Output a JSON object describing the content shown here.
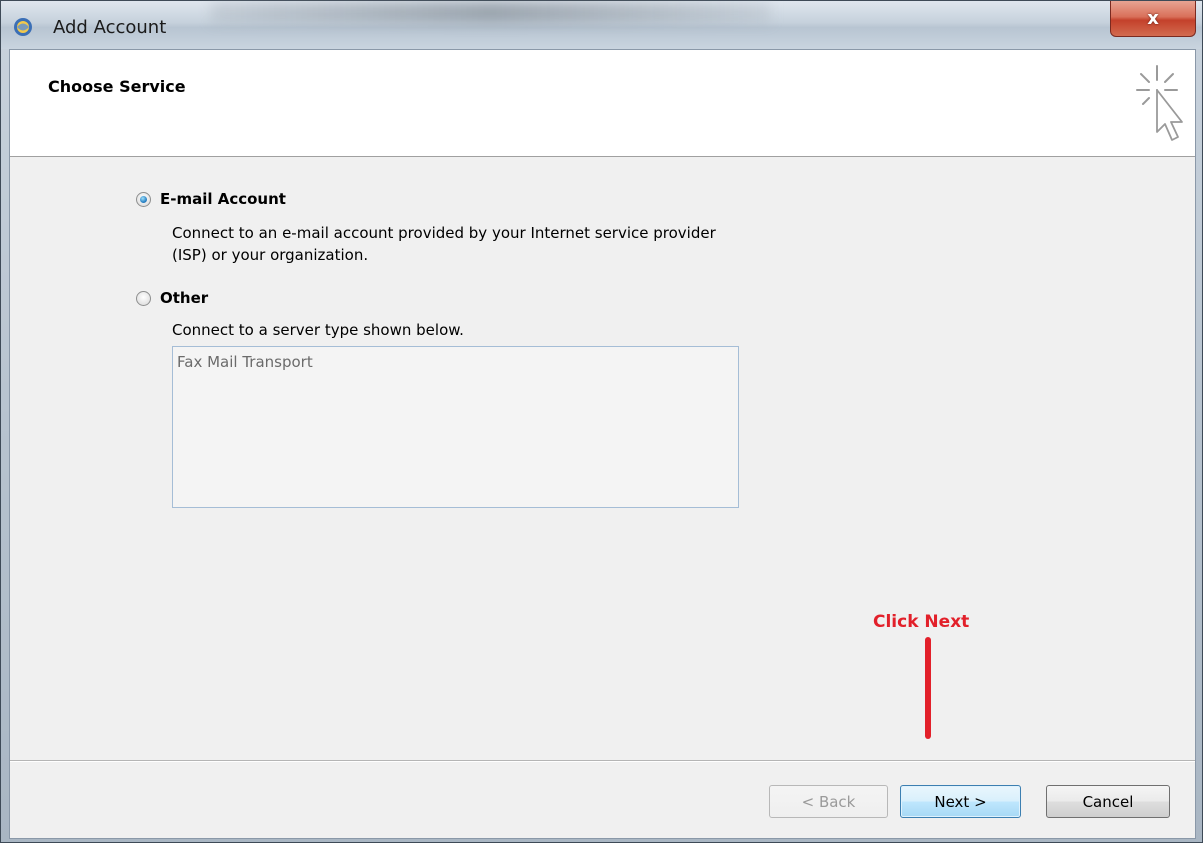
{
  "window": {
    "title": "Add Account",
    "close_label": "x"
  },
  "header": {
    "title": "Choose Service"
  },
  "options": {
    "email": {
      "label": "E-mail Account",
      "selected": true,
      "description_line1": "Connect to an e-mail account provided by your Internet service provider",
      "description_line2": "(ISP) or your organization."
    },
    "other": {
      "label": "Other",
      "selected": false,
      "description": "Connect to a server type shown below.",
      "list_items": [
        "Fax Mail Transport"
      ]
    }
  },
  "footer": {
    "back_label": "< Back",
    "next_label": "Next >",
    "cancel_label": "Cancel"
  },
  "annotation": {
    "text": "Click Next",
    "color": "#e2202a"
  }
}
